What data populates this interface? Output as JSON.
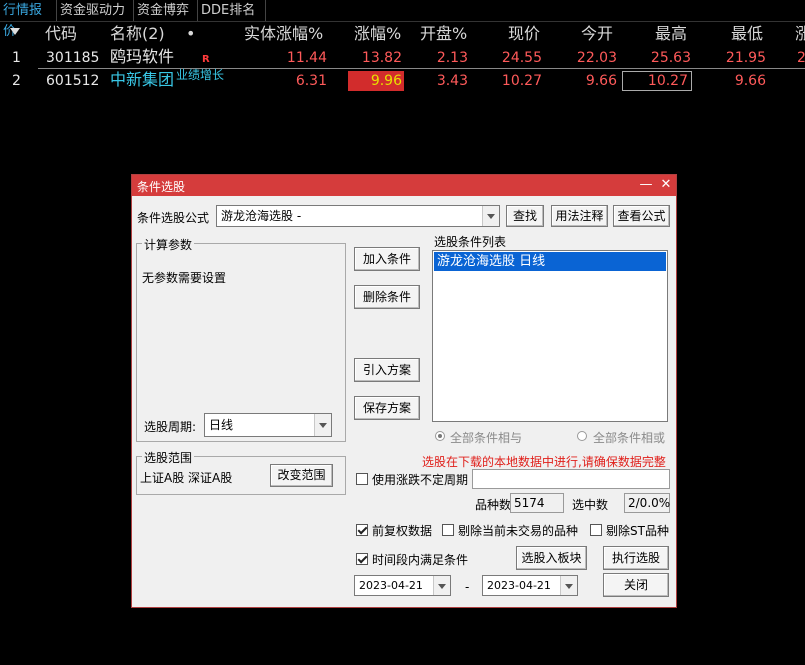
{
  "tabs": [
    "行情报价",
    "资金驱动力",
    "资金博弈",
    "DDE排名"
  ],
  "table": {
    "headers": {
      "code": "代码",
      "name": "名称(2)",
      "dot": "•",
      "entity_change": "实体涨幅%",
      "change_pct": "涨幅%",
      "open_pct": "开盘%",
      "price": "现价",
      "today_open": "今开",
      "high": "最高",
      "low": "最低",
      "more": "涨"
    },
    "rows": [
      {
        "index": "1",
        "code": "301185",
        "name": "鸥玛软件",
        "badge": "R",
        "entity_change": "11.44",
        "change_pct": "13.82",
        "open_pct": "2.13",
        "price": "24.55",
        "today_open": "22.03",
        "high": "25.63",
        "low": "21.95",
        "more": "2"
      },
      {
        "index": "2",
        "code": "601512",
        "name": "中新集团",
        "tag": "业绩增长",
        "entity_change": "6.31",
        "change_pct": "9.96",
        "open_pct": "3.43",
        "price": "10.27",
        "today_open": "9.66",
        "high": "10.27",
        "low": "9.66",
        "more": ""
      }
    ]
  },
  "dialog": {
    "title": "条件选股",
    "formula_label": "条件选股公式",
    "formula_value": "游龙沧海选股 -",
    "btn_search": "查找",
    "btn_usage": "用法注释",
    "btn_view_formula": "查看公式",
    "calc_params_caption": "计算参数",
    "no_params_text": "无参数需要设置",
    "period_label": "选股周期:",
    "period_value": "日线",
    "btn_add": "加入条件",
    "btn_delete": "删除条件",
    "btn_import": "引入方案",
    "btn_save": "保存方案",
    "cond_list_caption": "选股条件列表",
    "cond_items": [
      "游龙沧海选股  日线"
    ],
    "radio_and": "全部条件相与",
    "radio_or": "全部条件相或",
    "warning": "选股在下载的本地数据中进行,请确保数据完整",
    "range_caption": "选股范围",
    "range_value": "上证A股 深证A股",
    "btn_change_range": "改变范围",
    "chk_uncertain_period": "使用涨跌不定周期",
    "count_label": "品种数",
    "count_value": "5174",
    "selected_label": "选中数",
    "selected_value": "2/0.0%",
    "chk_pre_adjust": "前复权数据",
    "chk_exclude_untraded": "剔除当前未交易的品种",
    "chk_exclude_st": "剔除ST品种",
    "chk_time_range": "时间段内满足条件",
    "btn_to_block": "选股入板块",
    "btn_execute": "执行选股",
    "date_from": "2023-04-21",
    "date_sep": "-",
    "date_to": "2023-04-21",
    "btn_close": "关闭"
  }
}
